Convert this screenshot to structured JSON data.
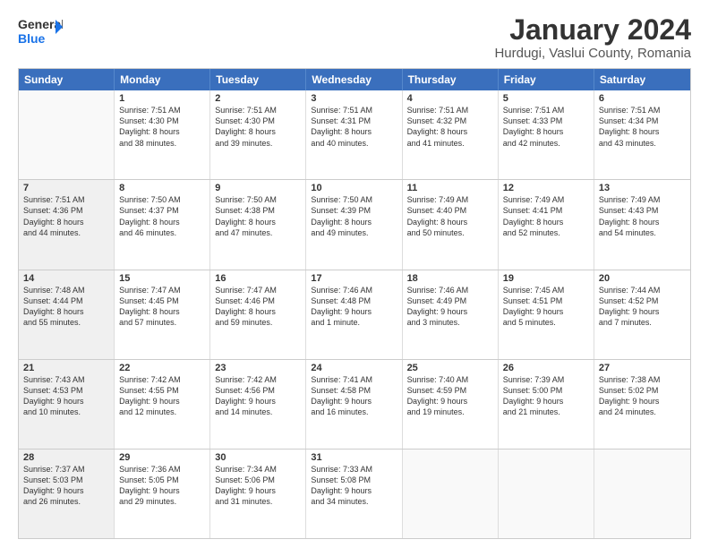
{
  "header": {
    "logo_general": "General",
    "logo_blue": "Blue",
    "title": "January 2024",
    "subtitle": "Hurdugi, Vaslui County, Romania"
  },
  "calendar": {
    "days": [
      "Sunday",
      "Monday",
      "Tuesday",
      "Wednesday",
      "Thursday",
      "Friday",
      "Saturday"
    ],
    "rows": [
      [
        {
          "num": "",
          "lines": [],
          "empty": true
        },
        {
          "num": "1",
          "lines": [
            "Sunrise: 7:51 AM",
            "Sunset: 4:30 PM",
            "Daylight: 8 hours",
            "and 38 minutes."
          ]
        },
        {
          "num": "2",
          "lines": [
            "Sunrise: 7:51 AM",
            "Sunset: 4:30 PM",
            "Daylight: 8 hours",
            "and 39 minutes."
          ]
        },
        {
          "num": "3",
          "lines": [
            "Sunrise: 7:51 AM",
            "Sunset: 4:31 PM",
            "Daylight: 8 hours",
            "and 40 minutes."
          ]
        },
        {
          "num": "4",
          "lines": [
            "Sunrise: 7:51 AM",
            "Sunset: 4:32 PM",
            "Daylight: 8 hours",
            "and 41 minutes."
          ]
        },
        {
          "num": "5",
          "lines": [
            "Sunrise: 7:51 AM",
            "Sunset: 4:33 PM",
            "Daylight: 8 hours",
            "and 42 minutes."
          ]
        },
        {
          "num": "6",
          "lines": [
            "Sunrise: 7:51 AM",
            "Sunset: 4:34 PM",
            "Daylight: 8 hours",
            "and 43 minutes."
          ]
        }
      ],
      [
        {
          "num": "7",
          "lines": [
            "Sunrise: 7:51 AM",
            "Sunset: 4:36 PM",
            "Daylight: 8 hours",
            "and 44 minutes."
          ],
          "shaded": true
        },
        {
          "num": "8",
          "lines": [
            "Sunrise: 7:50 AM",
            "Sunset: 4:37 PM",
            "Daylight: 8 hours",
            "and 46 minutes."
          ]
        },
        {
          "num": "9",
          "lines": [
            "Sunrise: 7:50 AM",
            "Sunset: 4:38 PM",
            "Daylight: 8 hours",
            "and 47 minutes."
          ]
        },
        {
          "num": "10",
          "lines": [
            "Sunrise: 7:50 AM",
            "Sunset: 4:39 PM",
            "Daylight: 8 hours",
            "and 49 minutes."
          ]
        },
        {
          "num": "11",
          "lines": [
            "Sunrise: 7:49 AM",
            "Sunset: 4:40 PM",
            "Daylight: 8 hours",
            "and 50 minutes."
          ]
        },
        {
          "num": "12",
          "lines": [
            "Sunrise: 7:49 AM",
            "Sunset: 4:41 PM",
            "Daylight: 8 hours",
            "and 52 minutes."
          ]
        },
        {
          "num": "13",
          "lines": [
            "Sunrise: 7:49 AM",
            "Sunset: 4:43 PM",
            "Daylight: 8 hours",
            "and 54 minutes."
          ]
        }
      ],
      [
        {
          "num": "14",
          "lines": [
            "Sunrise: 7:48 AM",
            "Sunset: 4:44 PM",
            "Daylight: 8 hours",
            "and 55 minutes."
          ],
          "shaded": true
        },
        {
          "num": "15",
          "lines": [
            "Sunrise: 7:47 AM",
            "Sunset: 4:45 PM",
            "Daylight: 8 hours",
            "and 57 minutes."
          ]
        },
        {
          "num": "16",
          "lines": [
            "Sunrise: 7:47 AM",
            "Sunset: 4:46 PM",
            "Daylight: 8 hours",
            "and 59 minutes."
          ]
        },
        {
          "num": "17",
          "lines": [
            "Sunrise: 7:46 AM",
            "Sunset: 4:48 PM",
            "Daylight: 9 hours",
            "and 1 minute."
          ]
        },
        {
          "num": "18",
          "lines": [
            "Sunrise: 7:46 AM",
            "Sunset: 4:49 PM",
            "Daylight: 9 hours",
            "and 3 minutes."
          ]
        },
        {
          "num": "19",
          "lines": [
            "Sunrise: 7:45 AM",
            "Sunset: 4:51 PM",
            "Daylight: 9 hours",
            "and 5 minutes."
          ]
        },
        {
          "num": "20",
          "lines": [
            "Sunrise: 7:44 AM",
            "Sunset: 4:52 PM",
            "Daylight: 9 hours",
            "and 7 minutes."
          ]
        }
      ],
      [
        {
          "num": "21",
          "lines": [
            "Sunrise: 7:43 AM",
            "Sunset: 4:53 PM",
            "Daylight: 9 hours",
            "and 10 minutes."
          ],
          "shaded": true
        },
        {
          "num": "22",
          "lines": [
            "Sunrise: 7:42 AM",
            "Sunset: 4:55 PM",
            "Daylight: 9 hours",
            "and 12 minutes."
          ]
        },
        {
          "num": "23",
          "lines": [
            "Sunrise: 7:42 AM",
            "Sunset: 4:56 PM",
            "Daylight: 9 hours",
            "and 14 minutes."
          ]
        },
        {
          "num": "24",
          "lines": [
            "Sunrise: 7:41 AM",
            "Sunset: 4:58 PM",
            "Daylight: 9 hours",
            "and 16 minutes."
          ]
        },
        {
          "num": "25",
          "lines": [
            "Sunrise: 7:40 AM",
            "Sunset: 4:59 PM",
            "Daylight: 9 hours",
            "and 19 minutes."
          ]
        },
        {
          "num": "26",
          "lines": [
            "Sunrise: 7:39 AM",
            "Sunset: 5:00 PM",
            "Daylight: 9 hours",
            "and 21 minutes."
          ]
        },
        {
          "num": "27",
          "lines": [
            "Sunrise: 7:38 AM",
            "Sunset: 5:02 PM",
            "Daylight: 9 hours",
            "and 24 minutes."
          ]
        }
      ],
      [
        {
          "num": "28",
          "lines": [
            "Sunrise: 7:37 AM",
            "Sunset: 5:03 PM",
            "Daylight: 9 hours",
            "and 26 minutes."
          ],
          "shaded": true
        },
        {
          "num": "29",
          "lines": [
            "Sunrise: 7:36 AM",
            "Sunset: 5:05 PM",
            "Daylight: 9 hours",
            "and 29 minutes."
          ]
        },
        {
          "num": "30",
          "lines": [
            "Sunrise: 7:34 AM",
            "Sunset: 5:06 PM",
            "Daylight: 9 hours",
            "and 31 minutes."
          ]
        },
        {
          "num": "31",
          "lines": [
            "Sunrise: 7:33 AM",
            "Sunset: 5:08 PM",
            "Daylight: 9 hours",
            "and 34 minutes."
          ]
        },
        {
          "num": "",
          "lines": [],
          "empty": true
        },
        {
          "num": "",
          "lines": [],
          "empty": true
        },
        {
          "num": "",
          "lines": [],
          "empty": true
        }
      ]
    ]
  }
}
